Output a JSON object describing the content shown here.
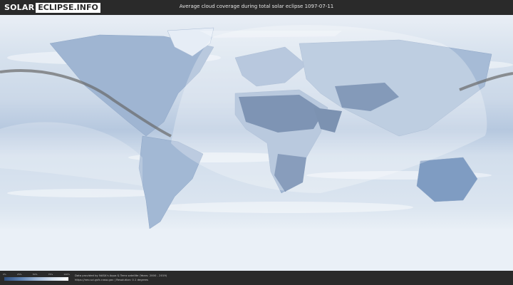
{
  "header": {
    "logo_part1": "SOLAR",
    "logo_part2": "ECLIPSE.INFO",
    "title": "Average cloud coverage during total solar eclipse 1097-07-11"
  },
  "legend": {
    "ticks": [
      "0%",
      "25%",
      "50%",
      "75%",
      "100%"
    ]
  },
  "footer": {
    "credit_line1": "Data provided by NASA's Aqua & Terra satellite (Years: 2000 - 2019)",
    "credit_line2": "https://neo.sci.gsfc.nasa.gov | Resolution: 0.1 degrees"
  },
  "colors": {
    "bar_bg": "#2a2a2a",
    "clear_sky": "#2f4f7f",
    "cloudy": "#ffffff",
    "eclipse_path": "#6a6a6a"
  }
}
